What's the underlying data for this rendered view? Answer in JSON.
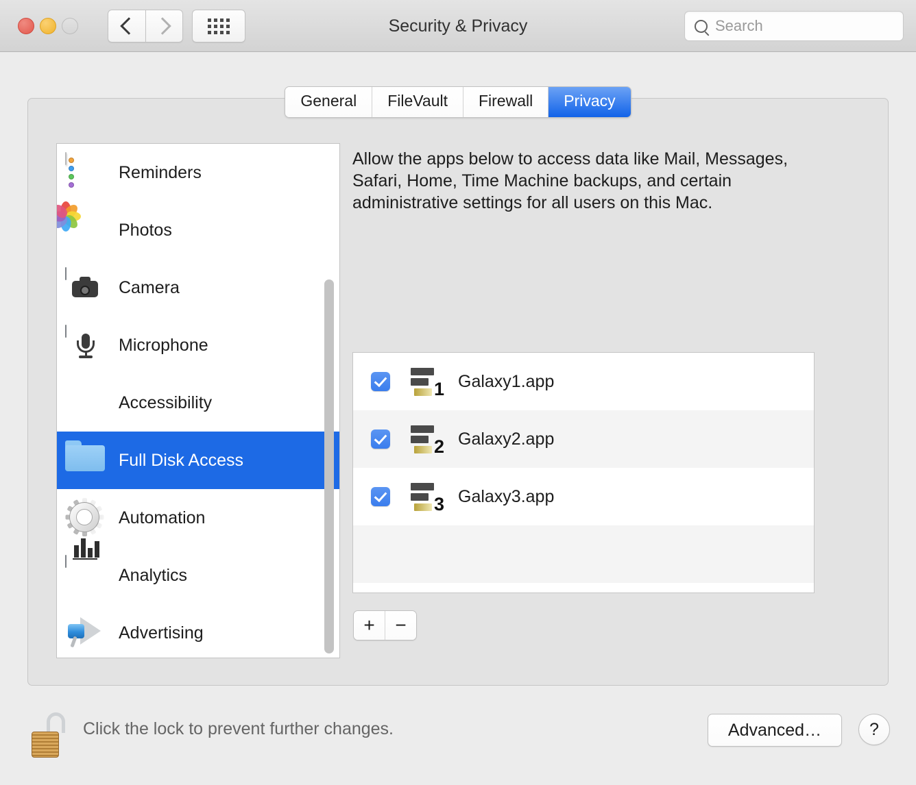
{
  "window": {
    "title": "Security & Privacy",
    "traffic_lights": [
      "close-red",
      "minimize-yellow",
      "zoom-disabled"
    ],
    "nav": {
      "back_icon": "chevron-left-icon",
      "forward_icon": "chevron-right-icon",
      "grid_icon": "grid-dots-icon"
    }
  },
  "search": {
    "placeholder": "Search",
    "value": "",
    "icon": "search-icon"
  },
  "tabs": [
    {
      "label": "General",
      "active": false
    },
    {
      "label": "FileVault",
      "active": false
    },
    {
      "label": "Firewall",
      "active": false
    },
    {
      "label": "Privacy",
      "active": true
    }
  ],
  "sidebar": {
    "items": [
      {
        "label": "Reminders",
        "icon": "reminders-icon",
        "selected": false
      },
      {
        "label": "Photos",
        "icon": "photos-icon",
        "selected": false
      },
      {
        "label": "Camera",
        "icon": "camera-icon",
        "selected": false
      },
      {
        "label": "Microphone",
        "icon": "microphone-icon",
        "selected": false
      },
      {
        "label": "Accessibility",
        "icon": "accessibility-icon",
        "selected": false
      },
      {
        "label": "Full Disk Access",
        "icon": "folder-icon",
        "selected": true
      },
      {
        "label": "Automation",
        "icon": "gear-icon",
        "selected": false
      },
      {
        "label": "Analytics",
        "icon": "analytics-icon",
        "selected": false
      },
      {
        "label": "Advertising",
        "icon": "megaphone-icon",
        "selected": false
      }
    ]
  },
  "main": {
    "description": "Allow the apps below to access data like Mail, Messages, Safari, Home, Time Machine backups, and certain administrative settings for all users on this Mac.",
    "apps": [
      {
        "name": "Galaxy1.app",
        "checked": true,
        "badge": "1"
      },
      {
        "name": "Galaxy2.app",
        "checked": true,
        "badge": "2"
      },
      {
        "name": "Galaxy3.app",
        "checked": true,
        "badge": "3"
      }
    ],
    "add_label": "+",
    "remove_label": "−"
  },
  "footer": {
    "lock_icon": "unlocked-padlock-icon",
    "lock_text": "Click the lock to prevent further changes.",
    "advanced_label": "Advanced…",
    "help_label": "?"
  },
  "colors": {
    "accent_blue": "#1d6ae5",
    "tab_active_blue": "#1263e8",
    "checkbox_blue": "#3a7ded",
    "window_bg": "#ececec",
    "panel_bg": "#e3e3e3"
  }
}
